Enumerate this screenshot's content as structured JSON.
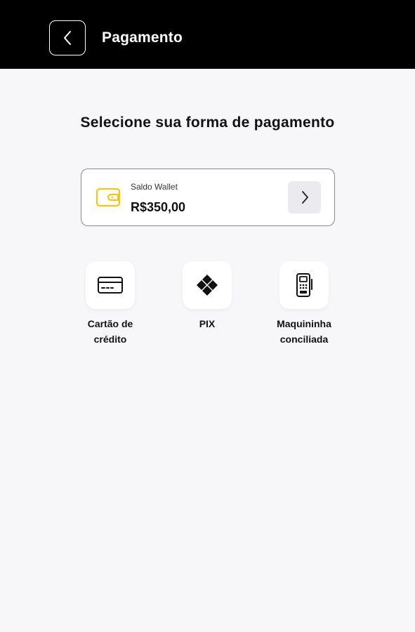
{
  "header": {
    "title": "Pagamento",
    "back_icon": "chevron-left-icon",
    "background": "#000000"
  },
  "main": {
    "title": "Selecione sua forma de pagamento"
  },
  "wallet": {
    "label": "Saldo Wallet",
    "value": "R$350,00",
    "icon": "wallet-icon",
    "icon_color": "#F5C518",
    "arrow_icon": "chevron-right-icon"
  },
  "methods": [
    {
      "label_line1": "Cartão de",
      "label_line2": "crédito",
      "icon": "credit-card-icon"
    },
    {
      "label_line1": "PIX",
      "label_line2": "",
      "icon": "pix-icon"
    },
    {
      "label_line1": "Maquininha",
      "label_line2": "conciliada",
      "icon": "card-terminal-icon"
    }
  ]
}
